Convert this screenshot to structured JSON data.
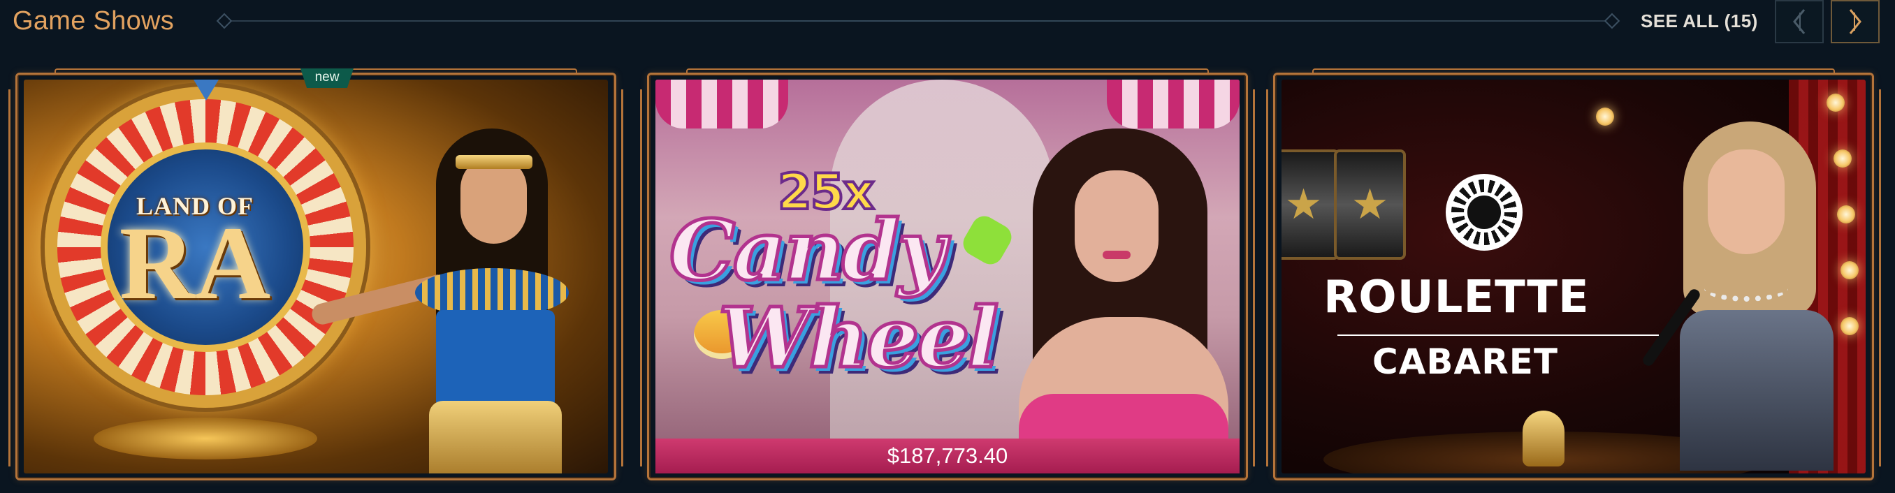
{
  "section": {
    "title": "Game Shows",
    "see_all_label": "SEE ALL (15)",
    "accent_color": "#e2a260"
  },
  "nav": {
    "prev_icon": "chevron-left-icon",
    "next_icon": "chevron-right-icon"
  },
  "games": [
    {
      "name": "Land of Ra",
      "art_top": "LAND OF",
      "art_main": "RA",
      "badge": "new"
    },
    {
      "name": "25x Candy Wheel",
      "art_multiplier": "25x",
      "art_line1": "Candy",
      "art_line2": "Wheel",
      "jackpot": "$187,773.40"
    },
    {
      "name": "Roulette Cabaret",
      "art_line1": "ROULETTE",
      "art_line2": "CABARET"
    }
  ]
}
